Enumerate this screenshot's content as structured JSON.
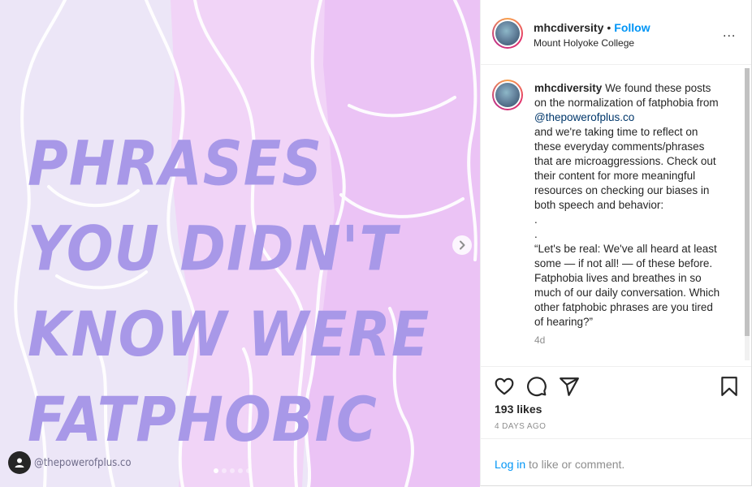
{
  "colors": {
    "link_blue": "#0095f6",
    "mention_blue": "#00376b",
    "headline_purple": "#a898e8",
    "bg_lavender": "#ece6f7",
    "bg_pink": "#ebc3f5"
  },
  "media": {
    "headline_lines": [
      "PHRASES",
      "YOU DIDN'T",
      "KNOW WERE",
      "FATPHOBIC"
    ],
    "credit": "@thepowerofplus.co",
    "credit_icon": "person-icon",
    "next_icon": "chevron-right-icon",
    "slide_dots": 5,
    "active_slide": 1
  },
  "header": {
    "username": "mhcdiversity",
    "separator": "•",
    "follow_label": "Follow",
    "location": "Mount Holyoke College",
    "more_label": "..."
  },
  "caption": {
    "username": "mhcdiversity",
    "text_before_mention": "We found these posts on the normalization of fatphobia from",
    "mention": "@thepowerofplus.co",
    "text_after_mention": "and we're taking time to reflect on these everyday comments/phrases that are microaggressions. Check out their content for more meaningful resources on checking our biases in both speech and behavior:",
    "spacer_1": ".",
    "spacer_2": ".",
    "quote": "“Let's be real: We've all heard at least some — if not all! — of these before. Fatphobia lives and breathes in so much of our daily conversation. Which other fatphobic phrases are you tired of hearing?”",
    "time_ago": "4d"
  },
  "actions": {
    "like_icon": "heart-icon",
    "comment_icon": "comment-icon",
    "share_icon": "send-icon",
    "save_icon": "bookmark-icon",
    "likes": "193 likes",
    "date": "4 DAYS AGO"
  },
  "login": {
    "link_label": "Log in",
    "rest_label": "to like or comment."
  }
}
